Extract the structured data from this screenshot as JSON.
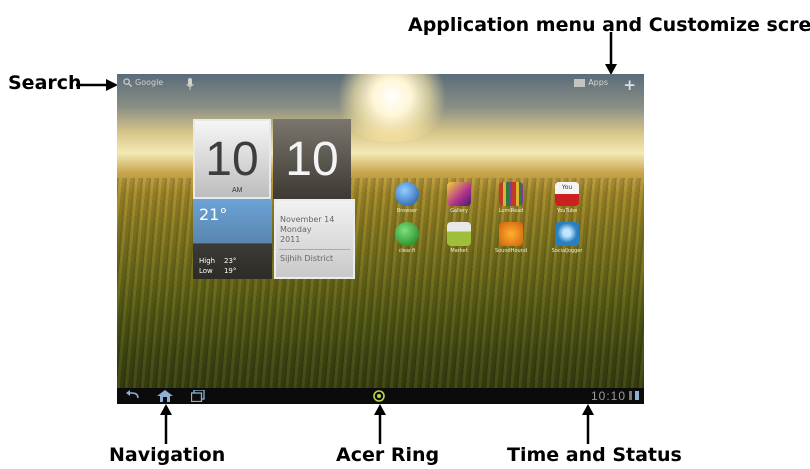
{
  "callouts": {
    "app_menu": "Application menu and Customize screen",
    "search": "Search",
    "navigation": "Navigation",
    "acer_ring": "Acer Ring",
    "time_status": "Time and Status"
  },
  "screen": {
    "search_label": "Google",
    "apps_label": "Apps",
    "clock": {
      "hour": "10",
      "minute": "10",
      "ampm": "AM"
    },
    "weather": {
      "temp": "21°",
      "high_label": "High",
      "high": "23°",
      "low_label": "Low",
      "low": "19°"
    },
    "date": {
      "line1": "November 14",
      "line2": "Monday",
      "line3": "2011",
      "location": "Sijhih District"
    },
    "apps": [
      {
        "label": "Browser",
        "color": "#2e6fc9"
      },
      {
        "label": "Gallery",
        "color": "#9b2b8f"
      },
      {
        "label": "LumiRead",
        "color": "#c0392b"
      },
      {
        "label": "YouTube",
        "color": "#cc1f1f"
      },
      {
        "label": "clear.fi",
        "color": "#2b8a2b"
      },
      {
        "label": "Market",
        "color": "#9fbf3a"
      },
      {
        "label": "SoundHound",
        "color": "#e07a12"
      },
      {
        "label": "SocialJogger",
        "color": "#2a7fc0"
      }
    ],
    "status_time": "10:10"
  }
}
